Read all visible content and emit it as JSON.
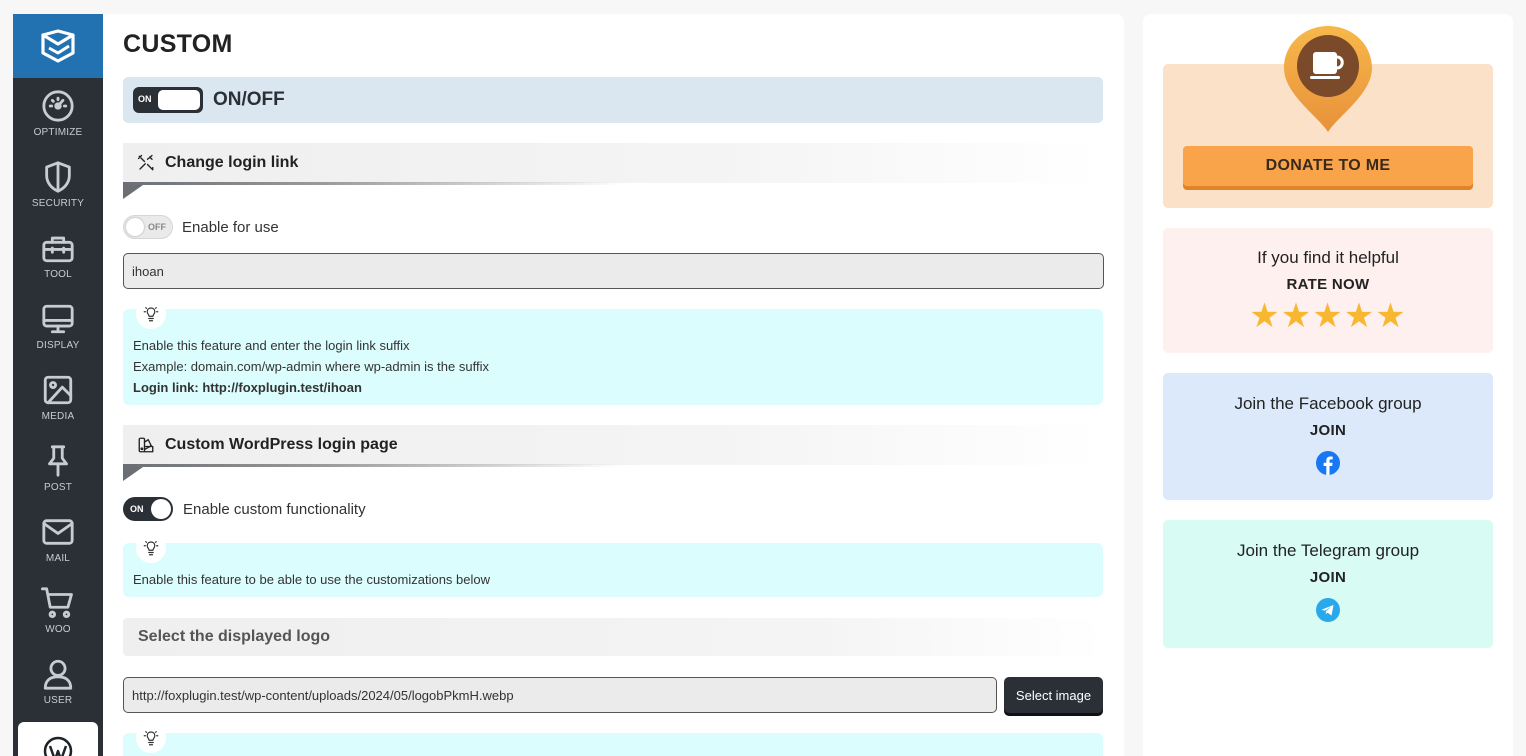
{
  "sidebar": {
    "items": [
      {
        "label": "OPTIMIZE",
        "icon": "gauge-icon"
      },
      {
        "label": "SECURITY",
        "icon": "shield-icon"
      },
      {
        "label": "TOOL",
        "icon": "toolbox-icon"
      },
      {
        "label": "DISPLAY",
        "icon": "monitor-icon"
      },
      {
        "label": "MEDIA",
        "icon": "image-icon"
      },
      {
        "label": "POST",
        "icon": "pin-icon"
      },
      {
        "label": "MAIL",
        "icon": "mail-icon"
      },
      {
        "label": "WOO",
        "icon": "cart-icon"
      },
      {
        "label": "USER",
        "icon": "user-icon"
      }
    ]
  },
  "main": {
    "title": "CUSTOM",
    "master_toggle": {
      "state": "ON",
      "label": "ON/OFF"
    },
    "login_link": {
      "heading": "Change login link",
      "toggle_state": "OFF",
      "toggle_label": "Enable for use",
      "input_value": "ihoan",
      "tip_line1": "Enable this feature and enter the login link suffix",
      "tip_line2": "Example: domain.com/wp-admin where wp-admin is the suffix",
      "tip_line3": "Login link: http://foxplugin.test/ihoan"
    },
    "login_page": {
      "heading": "Custom WordPress login page",
      "toggle_state": "ON",
      "toggle_label": "Enable custom functionality",
      "tip_line1": "Enable this feature to be able to use the customizations below"
    },
    "logo": {
      "heading": "Select the displayed logo",
      "input_value": "http://foxplugin.test/wp-content/uploads/2024/05/logobPkmH.webp",
      "button_label": "Select image"
    }
  },
  "right": {
    "donate_label": "DONATE TO ME",
    "rate_line1": "If you find it helpful",
    "rate_line2": "RATE NOW",
    "stars": "★★★★★",
    "fb_line1": "Join the Facebook group",
    "fb_line2": "JOIN",
    "tg_line1": "Join the Telegram group",
    "tg_line2": "JOIN"
  },
  "colors": {
    "sidebar_bg": "#2b3036",
    "accent_blue": "#2271b1",
    "donate_orange": "#f9a44b",
    "tip_bg": "#dcfdfd",
    "star": "#f7b731"
  }
}
